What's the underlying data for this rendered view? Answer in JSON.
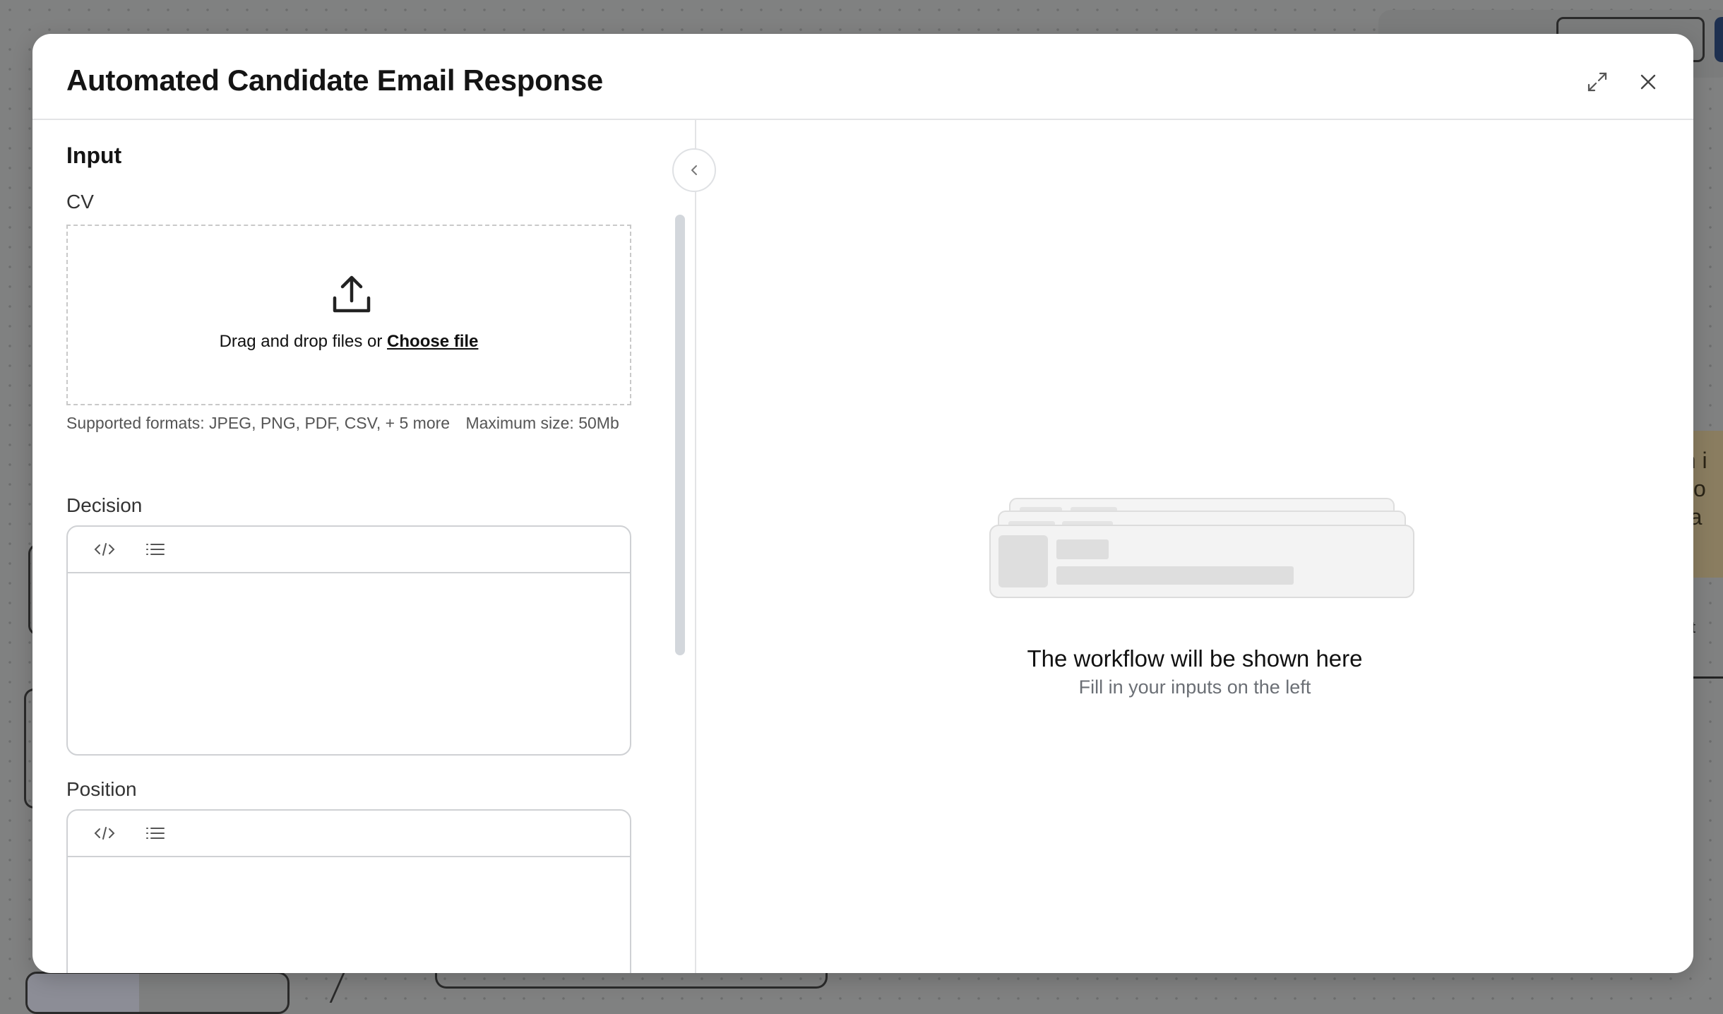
{
  "modal": {
    "title": "Automated Candidate Email Response",
    "expand_icon": "expand-icon",
    "close_icon": "close-icon"
  },
  "input_panel": {
    "section_title": "Input",
    "cv": {
      "label": "CV",
      "upload_icon": "upload-icon",
      "drop_text": "Drag and drop files or",
      "choose_file_link": "Choose file",
      "supported_formats": "Supported formats: JPEG, PNG, PDF, CSV, + 5 more",
      "max_size": "Maximum size: 50Mb"
    },
    "decision": {
      "label": "Decision",
      "toolbar_icons": [
        "code-icon",
        "list-icon"
      ],
      "value": ""
    },
    "position": {
      "label": "Position",
      "toolbar_icons": [
        "code-icon",
        "list-icon"
      ],
      "value": ""
    },
    "collapse_icon": "chevron-left-icon"
  },
  "workflow_panel": {
    "empty_title": "The workflow will be shown here",
    "empty_subtitle": "Fill in your inputs on the left"
  },
  "background": {
    "note_lines": [
      "an i",
      "il to",
      "ma"
    ],
    "ext_text": "xt"
  }
}
